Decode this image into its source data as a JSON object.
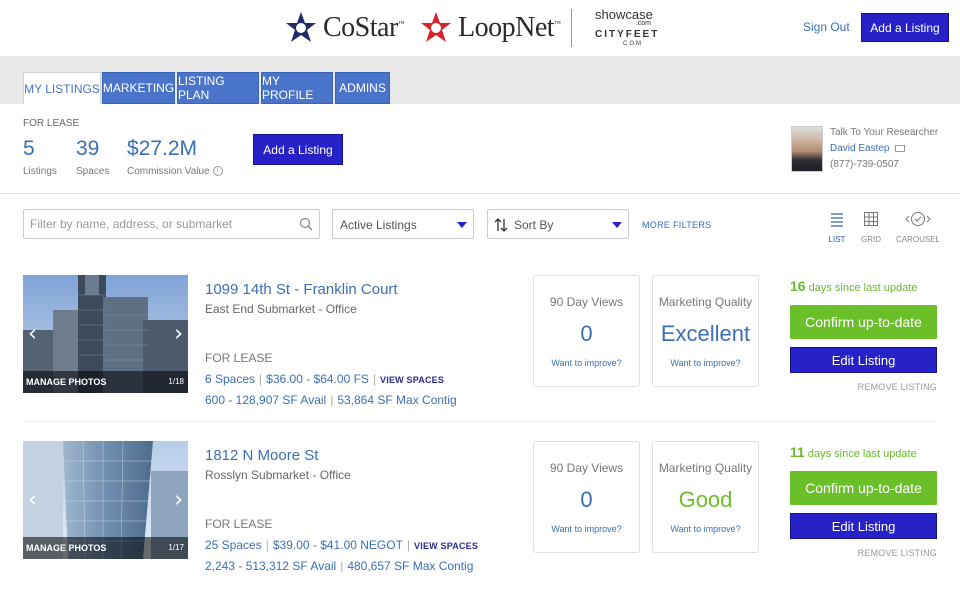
{
  "header": {
    "brands": {
      "costar": "CoStar",
      "loopnet": "LoopNet",
      "showcase": "showcase",
      "showcase_com": ".com",
      "cityfeet": "CITYFEET",
      "cityfeet_com": "COM"
    },
    "sign_out": "Sign Out",
    "add_listing": "Add a Listing",
    "colors": {
      "primary_button": "#2622c7",
      "costar_navy": "#1f2a6b",
      "loopnet_red": "#d8232a"
    }
  },
  "tabs": [
    {
      "label": "MY LISTINGS",
      "active": true
    },
    {
      "label": "MARKETING",
      "active": false
    },
    {
      "label": "LISTING PLAN",
      "active": false
    },
    {
      "label": "MY PROFILE",
      "active": false
    },
    {
      "label": "ADMINS",
      "active": false
    }
  ],
  "summary": {
    "for_lease": "FOR LEASE",
    "listings": {
      "value": "5",
      "label": "Listings"
    },
    "spaces": {
      "value": "39",
      "label": "Spaces"
    },
    "commission": {
      "value": "$27.2M",
      "label": "Commission Value"
    },
    "info_icon": "i",
    "add_listing": "Add a Listing",
    "researcher": {
      "title": "Talk To Your Researcher",
      "name": "David Eastep",
      "phone": "(877)-739-0507"
    }
  },
  "filters": {
    "search_placeholder": "Filter by name, address, or submarket",
    "status": "Active Listings",
    "sort": "Sort By",
    "more_filters": "MORE FILTERS",
    "views": [
      {
        "label": "LIST",
        "icon": "list-icon",
        "active": true
      },
      {
        "label": "GRID",
        "icon": "grid-icon",
        "active": false
      },
      {
        "label": "CAROUSEL",
        "icon": "carousel-icon",
        "active": false
      }
    ]
  },
  "listings": [
    {
      "address": "1099 14th St - Franklin Court",
      "submarket": "East End Submarket - Office",
      "for_lease": "FOR LEASE",
      "spaces": "6 Spaces",
      "rate": "$36.00 - $64.00 FS",
      "view_spaces": "VIEW SPACES",
      "sf_avail": "600 - 128,907 SF Avail",
      "max_contig": "53,864 SF Max Contig",
      "manage_photos": "MANAGE PHOTOS",
      "photo_count": "1/18",
      "views_title": "90 Day Views",
      "views_value": "0",
      "views_improve": "Want to improve?",
      "quality_title": "Marketing Quality",
      "quality_value": "Excellent",
      "quality_color": "#3b6fb4",
      "quality_improve": "Want to improve?",
      "days_num": "16",
      "days_text": "days since last update",
      "confirm": "Confirm up-to-date",
      "edit": "Edit Listing",
      "remove": "REMOVE LISTING"
    },
    {
      "address": "1812 N Moore St",
      "submarket": "Rosslyn Submarket - Office",
      "for_lease": "FOR LEASE",
      "spaces": "25 Spaces",
      "rate": "$39.00 - $41.00 NEGOT",
      "view_spaces": "VIEW SPACES",
      "sf_avail": "2,243 - 513,312 SF Avail",
      "max_contig": "480,657 SF Max Contig",
      "manage_photos": "MANAGE PHOTOS",
      "photo_count": "1/17",
      "views_title": "90 Day Views",
      "views_value": "0",
      "views_improve": "Want to improve?",
      "quality_title": "Marketing Quality",
      "quality_value": "Good",
      "quality_color": "#6bc02a",
      "quality_improve": "Want to improve?",
      "days_num": "11",
      "days_text": "days since last update",
      "confirm": "Confirm up-to-date",
      "edit": "Edit Listing",
      "remove": "REMOVE LISTING"
    }
  ]
}
